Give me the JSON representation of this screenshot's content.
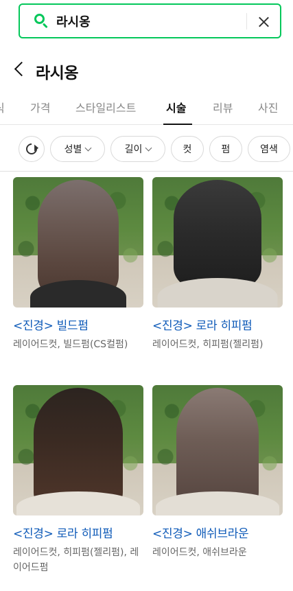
{
  "search": {
    "value": "라시옹",
    "icon": "search-icon",
    "clear_icon": "close-icon",
    "accent": "#03c75a"
  },
  "header": {
    "title": "라시옹",
    "back_icon": "chevron-left-icon"
  },
  "tabs": [
    {
      "label": "식",
      "active": false
    },
    {
      "label": "가격",
      "active": false
    },
    {
      "label": "스타일리스트",
      "active": false
    },
    {
      "label": "시술",
      "active": true
    },
    {
      "label": "리뷰",
      "active": false
    },
    {
      "label": "사진",
      "active": false
    }
  ],
  "filters": {
    "refresh_icon": "refresh-icon",
    "chips": [
      {
        "label": "성별",
        "dropdown": true
      },
      {
        "label": "길이",
        "dropdown": true
      },
      {
        "label": "컷",
        "dropdown": false
      },
      {
        "label": "펌",
        "dropdown": false
      },
      {
        "label": "염색",
        "dropdown": false
      }
    ]
  },
  "items": [
    {
      "title": "<진경> 빌드펌",
      "desc": "레이어드컷, 빌드펌(CS컬펌)"
    },
    {
      "title": "<진경> 로라 히피펌",
      "desc": "레이어드컷, 히피펌(젤리펌)"
    },
    {
      "title": "<진경> 로라 히피펌",
      "desc": "레이어드컷, 히피펌(젤리펌), 레이어드펌"
    },
    {
      "title": "<진경> 애쉬브라운",
      "desc": "레이어드컷, 애쉬브라운"
    }
  ],
  "colors": {
    "link": "#0e5ab8",
    "muted": "#666666"
  }
}
